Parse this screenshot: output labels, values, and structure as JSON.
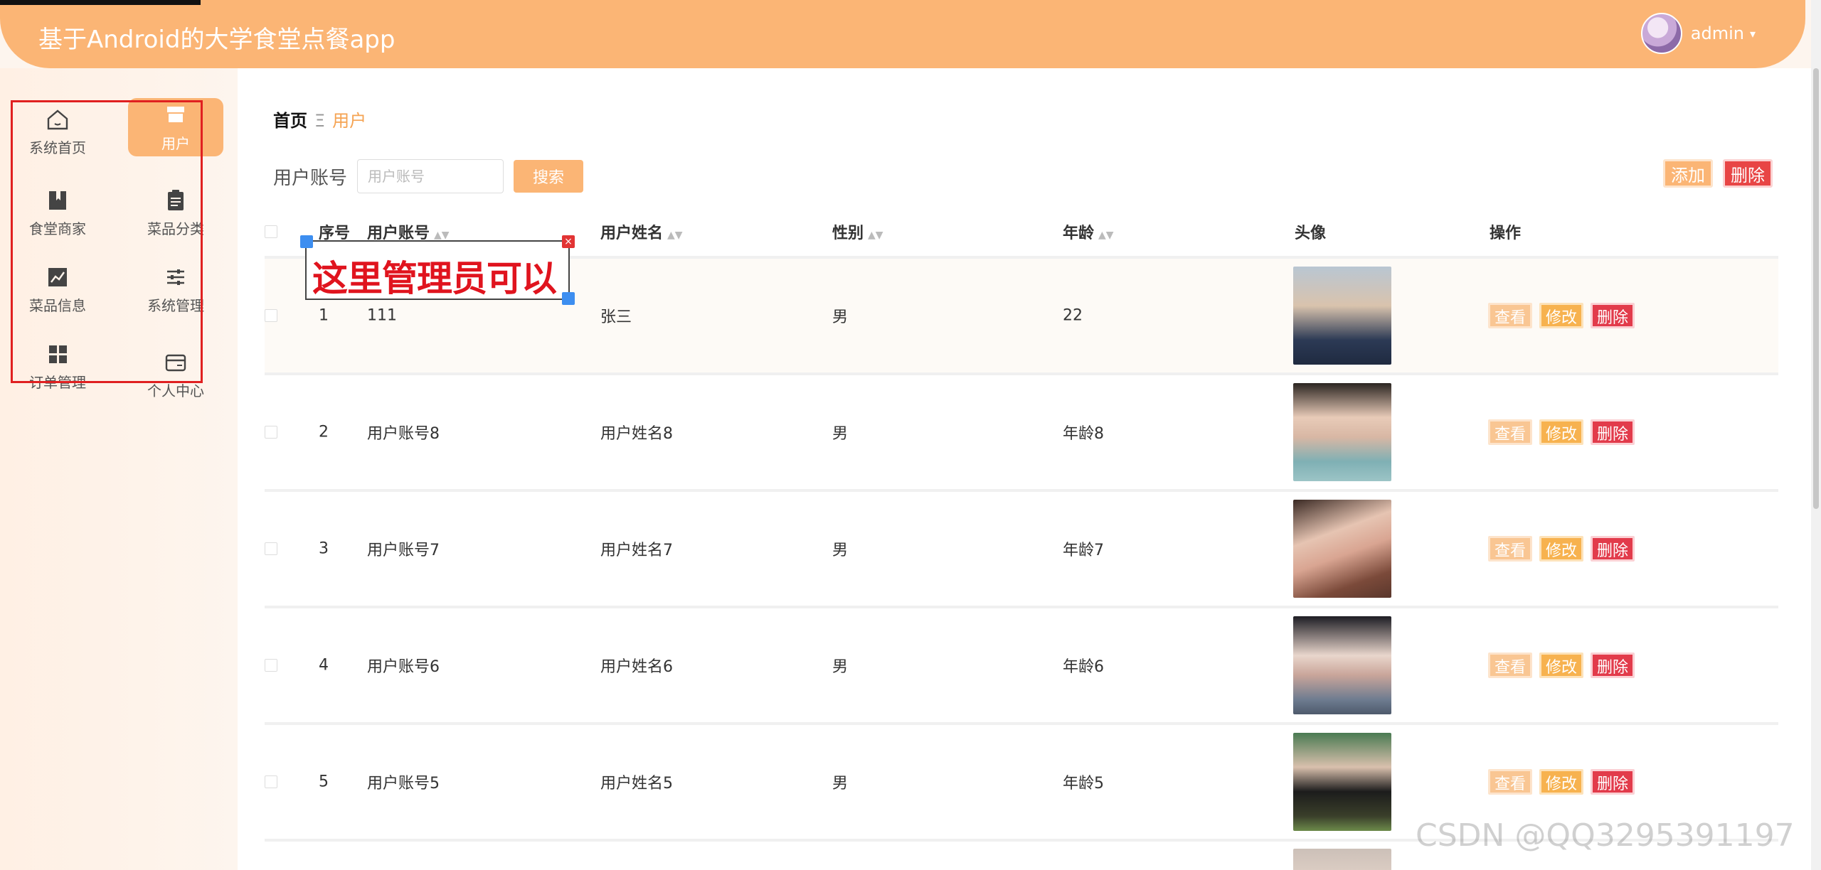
{
  "app": {
    "title": "基于Android的大学食堂点餐app",
    "username": "admin"
  },
  "sidebar": {
    "items": [
      {
        "label": "系统首页",
        "icon": "home-icon"
      },
      {
        "label": "用户",
        "icon": "store-icon",
        "active": true
      },
      {
        "label": "食堂商家",
        "icon": "book-icon"
      },
      {
        "label": "菜品分类",
        "icon": "clipboard-icon"
      },
      {
        "label": "菜品信息",
        "icon": "chart-icon"
      },
      {
        "label": "系统管理",
        "icon": "sliders-icon"
      },
      {
        "label": "订单管理",
        "icon": "grid-icon"
      },
      {
        "label": "个人中心",
        "icon": "card-icon"
      }
    ]
  },
  "breadcrumb": {
    "home": "首页",
    "separator": "Ξ",
    "current": "用户"
  },
  "search": {
    "label": "用户账号",
    "placeholder": "用户账号",
    "button": "搜索"
  },
  "actions": {
    "add": "添加",
    "delete": "删除"
  },
  "table": {
    "headers": {
      "index": "序号",
      "account": "用户账号",
      "name": "用户姓名",
      "gender": "性别",
      "age": "年龄",
      "avatar": "头像",
      "ops": "操作"
    },
    "op_labels": {
      "view": "查看",
      "edit": "修改",
      "delete": "删除"
    },
    "rows": [
      {
        "index": "1",
        "account": "111",
        "name": "张三",
        "gender": "男",
        "age": "22"
      },
      {
        "index": "2",
        "account": "用户账号8",
        "name": "用户姓名8",
        "gender": "男",
        "age": "年龄8"
      },
      {
        "index": "3",
        "account": "用户账号7",
        "name": "用户姓名7",
        "gender": "男",
        "age": "年龄7"
      },
      {
        "index": "4",
        "account": "用户账号6",
        "name": "用户姓名6",
        "gender": "男",
        "age": "年龄6"
      },
      {
        "index": "5",
        "account": "用户账号5",
        "name": "用户姓名5",
        "gender": "男",
        "age": "年龄5"
      }
    ]
  },
  "annotation": {
    "text": "这里管理员可以"
  },
  "watermark": "CSDN @QQ3295391197",
  "colors": {
    "accent": "#fbb575",
    "danger": "#e23b4b",
    "annotation": "#e0141e"
  }
}
